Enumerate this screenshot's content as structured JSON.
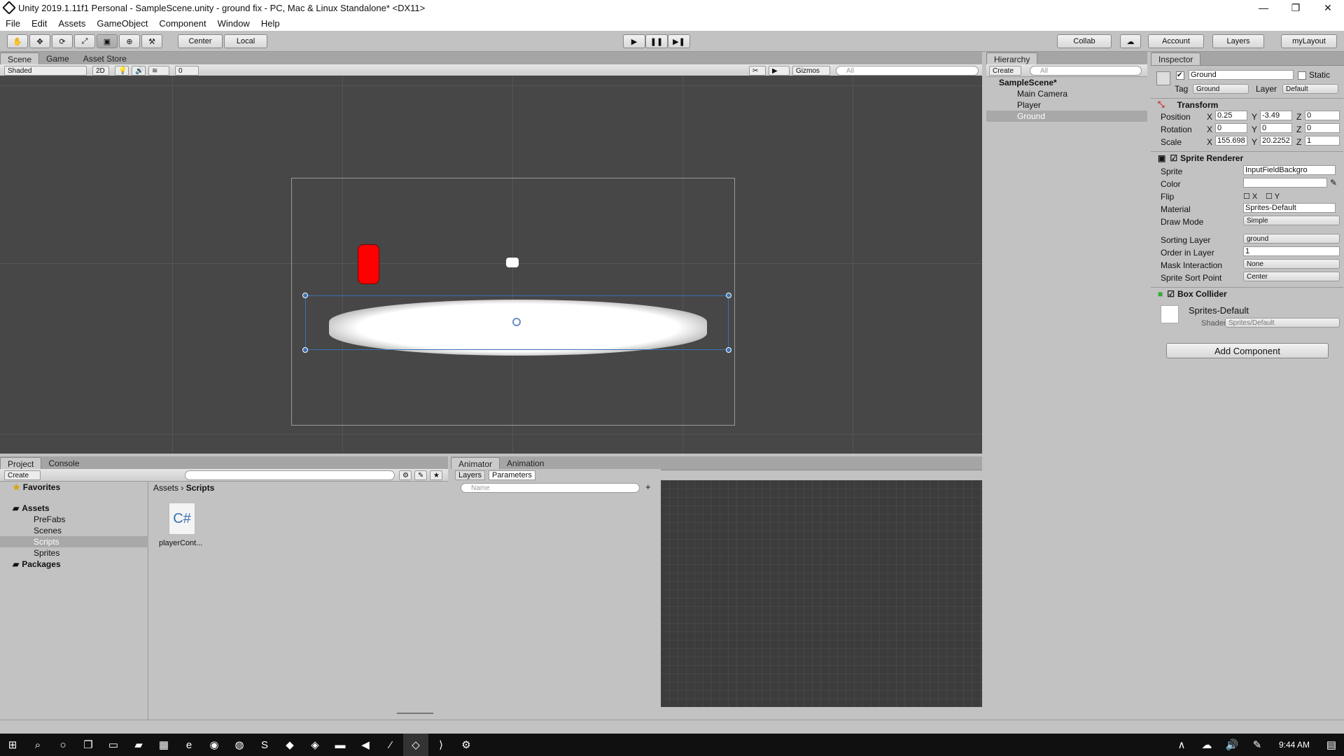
{
  "window": {
    "title": "Unity 2019.1.11f1 Personal - SampleScene.unity - ground fix - PC, Mac & Linux Standalone* <DX11>",
    "minimize": "—",
    "maximize": "❐",
    "close": "✕"
  },
  "menu": [
    "File",
    "Edit",
    "Assets",
    "GameObject",
    "Component",
    "Window",
    "Help"
  ],
  "toolbar": {
    "center": "Center",
    "local": "Local",
    "collab": "Collab",
    "account": "Account",
    "layers": "Layers",
    "layout": "myLayout",
    "play": "▶",
    "pause": "❚❚",
    "step": "▶❚",
    "tools": [
      "✋",
      "✥",
      "⟳",
      "⤢",
      "▣",
      "⊕",
      "⚒"
    ]
  },
  "scene": {
    "tabs": [
      "Scene",
      "Game",
      "Asset Store"
    ],
    "shading": "Shaded",
    "mode2d": "2D",
    "gizmos": "Gizmos",
    "search_placeholder": "All",
    "hidden_count": "0"
  },
  "project": {
    "tabs": [
      "Project",
      "Console"
    ],
    "create": "Create",
    "favorites": "Favorites",
    "assets": "Assets",
    "folders": [
      "PreFabs",
      "Scenes",
      "Scripts",
      "Sprites"
    ],
    "packages": "Packages",
    "breadcrumb": [
      "Assets",
      "Scripts"
    ],
    "file_name": "playerCont...",
    "file_icon": "C#"
  },
  "animator": {
    "tabs": [
      "Animator",
      "Animation"
    ],
    "subtabs": [
      "Layers",
      "Parameters"
    ],
    "search_placeholder": "Name",
    "add": "+"
  },
  "hierarchy": {
    "tab": "Hierarchy",
    "create": "Create",
    "search_placeholder": "All",
    "scene": "SampleScene*",
    "items": [
      "Main Camera",
      "Player",
      "Ground"
    ]
  },
  "inspector": {
    "tab": "Inspector",
    "name": "Ground",
    "static": "Static",
    "tag_label": "Tag",
    "tag": "Ground",
    "layer_label": "Layer",
    "layer": "Default",
    "transform": {
      "title": "Transform",
      "position_label": "Position",
      "rotation_label": "Rotation",
      "scale_label": "Scale",
      "position": {
        "x": "0.25",
        "y": "-3.49",
        "z": "0"
      },
      "rotation": {
        "x": "0",
        "y": "0",
        "z": "0"
      },
      "scale": {
        "x": "155.698",
        "y": "20.2252",
        "z": "1"
      }
    },
    "sprite_renderer": {
      "title": "Sprite Renderer",
      "sprite_label": "Sprite",
      "sprite": "InputFieldBackgro",
      "color_label": "Color",
      "flip_label": "Flip",
      "flip_x": "X",
      "flip_y": "Y",
      "material_label": "Material",
      "material": "Sprites-Default",
      "draw_mode_label": "Draw Mode",
      "draw_mode": "Simple",
      "sorting_layer_label": "Sorting Layer",
      "sorting_layer": "ground",
      "order_label": "Order in Layer",
      "order": "1",
      "mask_label": "Mask Interaction",
      "mask": "None",
      "sort_point_label": "Sprite Sort Point",
      "sort_point": "Center"
    },
    "box_collider": {
      "title": "Box Collider"
    },
    "material": {
      "name": "Sprites-Default",
      "shader_label": "Shader",
      "shader": "Sprites/Default"
    },
    "add_component": "Add Component"
  },
  "taskbar": {
    "time": "9:44 AM"
  },
  "colors": {
    "accent": "#3a72b0",
    "scene_bg": "#474747",
    "player": "#ff0000"
  }
}
